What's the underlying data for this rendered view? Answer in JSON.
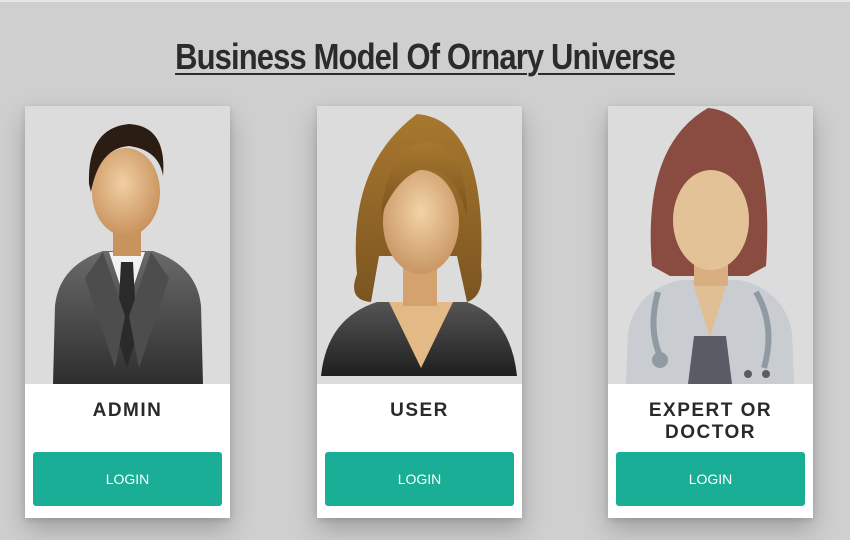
{
  "page": {
    "title": "Business Model Of Ornary Universe"
  },
  "colors": {
    "background": "#cfcfcf",
    "card": "#ffffff",
    "accent": "#1aae96"
  },
  "cards": [
    {
      "role": "ADMIN",
      "button_label": "LOGIN",
      "avatar_icon": "businessman-avatar-icon"
    },
    {
      "role": "USER",
      "button_label": "LOGIN",
      "avatar_icon": "woman-user-avatar-icon"
    },
    {
      "role": "EXPERT OR DOCTOR",
      "button_label": "LOGIN",
      "avatar_icon": "doctor-avatar-icon"
    }
  ]
}
